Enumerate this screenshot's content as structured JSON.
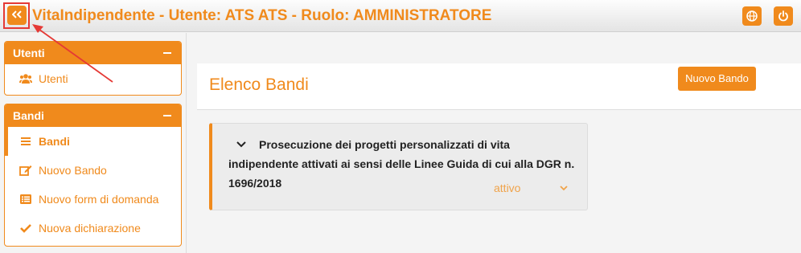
{
  "header": {
    "title": "VitaIndipendente - Utente: ATS ATS - Ruolo: AMMINISTRATORE",
    "collapse_icon": "double-chevron-left-icon",
    "language_icon": "globe-icon",
    "logout_icon": "power-icon"
  },
  "sidebar": {
    "panels": [
      {
        "title": "Utenti",
        "items": [
          {
            "label": "Utenti",
            "icon": "users-icon"
          }
        ]
      },
      {
        "title": "Bandi",
        "items": [
          {
            "label": "Bandi",
            "icon": "list-icon",
            "active": true
          },
          {
            "label": "Nuovo Bando",
            "icon": "edit-icon"
          },
          {
            "label": "Nuovo form di domanda",
            "icon": "list-alt-icon"
          },
          {
            "label": "Nuova dichiarazione",
            "icon": "check-icon"
          }
        ]
      }
    ]
  },
  "main": {
    "title": "Elenco Bandi",
    "new_button": "Nuovo Bando",
    "bandi": [
      {
        "title": "Prosecuzione dei progetti personalizzati di vita indipendente attivati ai sensi delle Linee Guida di cui alla DGR n. 1696/2018",
        "status": "attivo"
      }
    ]
  },
  "colors": {
    "accent": "#f08a1c",
    "highlight": "#e53935"
  }
}
